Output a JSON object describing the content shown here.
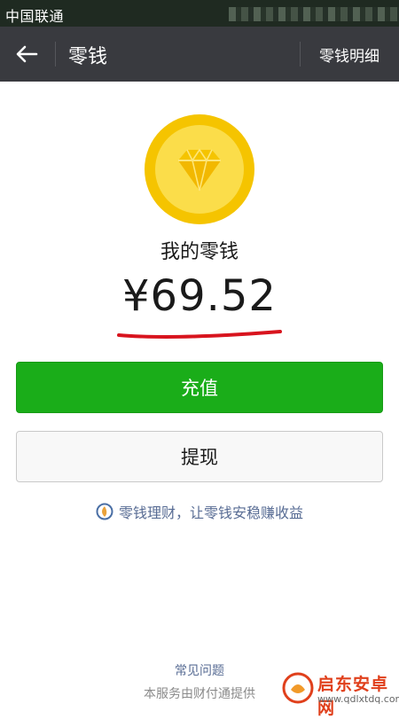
{
  "status_bar": {
    "carrier": "中国联通"
  },
  "header": {
    "back_icon": "arrow-left-icon",
    "title": "零钱",
    "action_label": "零钱明细"
  },
  "wallet": {
    "icon": "diamond-coin-icon",
    "label": "我的零钱",
    "balance": "¥69.52",
    "highlight_color": "#d8141e"
  },
  "actions": {
    "recharge_label": "充值",
    "withdraw_label": "提现"
  },
  "promo": {
    "icon": "licaitong-icon",
    "text": "零钱理财，让零钱安稳赚收益"
  },
  "footer": {
    "faq_label": "常见问题",
    "provider_text": "本服务由财付通提供"
  },
  "watermark": {
    "title": "启东安卓网",
    "url": "www.qdlxtdq.com"
  },
  "colors": {
    "header_bg": "#393a3f",
    "primary_green": "#1aad19",
    "link_blue": "#586c94",
    "coin_yellow": "#f5c400"
  }
}
